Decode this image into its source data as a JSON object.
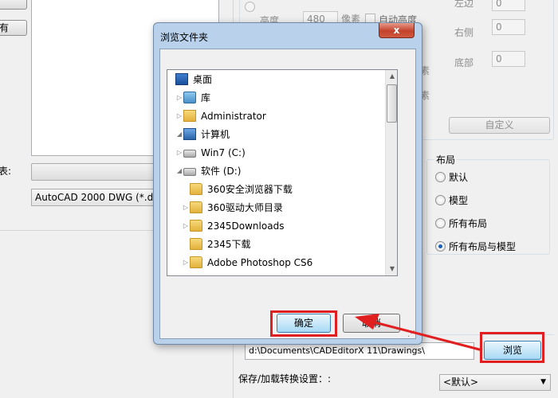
{
  "background": {
    "left_button_label": "有",
    "left_label": "表:",
    "format_select": "AutoCAD 2000 DWG (*.dwg)",
    "height_label": "高度",
    "height_value": "480",
    "pixel_label": "像素",
    "pixel_label_2": "素",
    "pixel_label_3": "素",
    "auto_height_label": "自动高度",
    "margin_top": "左边",
    "margin_right_label": "右侧",
    "margin_right_value": "0",
    "margin_bottom_label": "底部",
    "margin_bottom_value": "0",
    "margin_top_value": "0",
    "custom_button": "自定义",
    "layout_title": "布局",
    "layout_options": [
      "默认",
      "模型",
      "所有布局",
      "所有布局与模型"
    ],
    "path_value": "d:\\Documents\\CADEditorX 11\\Drawings\\",
    "browse_button": "浏览",
    "save_settings_label": "保存/加载转换设置：:",
    "default_select": "<默认>"
  },
  "dialog": {
    "title": "浏览文件夹",
    "close": "x",
    "tree": [
      {
        "label": "桌面",
        "icon": "desktop-icon",
        "indent": 0,
        "expander": ""
      },
      {
        "label": "库",
        "icon": "library-icon",
        "indent": 1,
        "expander": "▷"
      },
      {
        "label": "Administrator",
        "icon": "user-folder-icon",
        "indent": 1,
        "expander": "▷"
      },
      {
        "label": "计算机",
        "icon": "computer-icon",
        "indent": 1,
        "expander": "◢"
      },
      {
        "label": "Win7 (C:)",
        "icon": "drive-icon",
        "indent": 2,
        "expander": "▷"
      },
      {
        "label": "软件 (D:)",
        "icon": "drive-icon",
        "indent": 2,
        "expander": "◢"
      },
      {
        "label": "360安全浏览器下载",
        "icon": "folder-icon",
        "indent": 3,
        "expander": ""
      },
      {
        "label": "360驱动大师目录",
        "icon": "folder-icon",
        "indent": 3,
        "expander": "▷"
      },
      {
        "label": "2345Downloads",
        "icon": "folder-icon",
        "indent": 3,
        "expander": "▷"
      },
      {
        "label": "2345下载",
        "icon": "folder-icon",
        "indent": 3,
        "expander": ""
      },
      {
        "label": "Adobe Photoshop CS6",
        "icon": "folder-icon",
        "indent": 3,
        "expander": "▷"
      }
    ],
    "ok_button": "确定",
    "cancel_button": "取消"
  },
  "colors": {
    "highlight": "#e02020",
    "dialog_frame": "#b9d1ea"
  }
}
